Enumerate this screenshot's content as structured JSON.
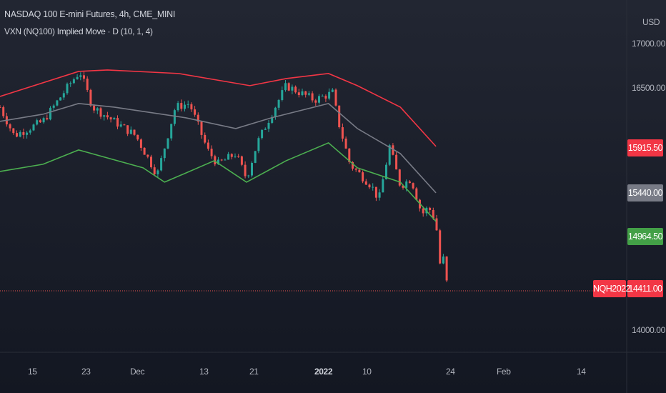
{
  "header": {
    "title": "NASDAQ 100 E-mini Futures, 4h, CME_MINI",
    "indicator": "VXN (NQ100) Implied Move · D (10, 1, 4)"
  },
  "price_axis": {
    "currency": "USD",
    "ticks": [
      "17000.00",
      "16500.00",
      "14000.00"
    ]
  },
  "time_axis": {
    "ticks": [
      "15",
      "23",
      "Dec",
      "13",
      "21",
      "2022",
      "10",
      "24",
      "Feb",
      "14"
    ]
  },
  "tags": {
    "upper": "15915.50",
    "mid": "15440.00",
    "lower": "14964.50",
    "last": "14411.00",
    "symbol": "NQH2022"
  },
  "colors": {
    "upper": "#f23645",
    "mid": "#787b86",
    "lower": "#4caf50",
    "up": "#26a69a",
    "down": "#ef5350"
  },
  "chart_data": {
    "type": "candlestick",
    "title": "NASDAQ 100 E-mini Futures, 4h, CME_MINI",
    "ylim": [
      13700,
      17300
    ],
    "x_unit": "days since 2021-11-10",
    "close": {
      "x": [
        0,
        2.1,
        6.4,
        10.6,
        11.9,
        13.8,
        17,
        20.2,
        23.4,
        26.1,
        28.2,
        30.9,
        32.4,
        35.1,
        36.7,
        38.3,
        40.4,
        42.6,
        44.7,
        46.8,
        49.5,
        50.5,
        52.1,
        55.3,
        56.4,
        58,
        59.6,
        61.2,
        62.8,
        63.8,
        64.9,
        65.4,
        66.2,
        66.6
      ],
      "y": [
        16334,
        16035,
        16185,
        16596,
        16708,
        16334,
        16185,
        16035,
        15624,
        16334,
        16372,
        15886,
        15736,
        15848,
        15586,
        15960,
        16260,
        16559,
        16484,
        16409,
        16484,
        16147,
        15736,
        15511,
        15362,
        15923,
        15511,
        15586,
        15212,
        15287,
        15138,
        14689,
        14764,
        14411
      ]
    },
    "series": [
      {
        "name": "Upper",
        "x": [
          0,
          11.7,
          16,
          26.6,
          37.2,
          42.6,
          48.9,
          53.2,
          59.6,
          64.9
        ],
        "y": [
          16446,
          16708,
          16723,
          16686,
          16559,
          16633,
          16686,
          16559,
          16334,
          15923
        ]
      },
      {
        "name": "Mid",
        "x": [
          0,
          6.4,
          11.7,
          17,
          27.7,
          35.1,
          40.4,
          48.9,
          53.2,
          59.6,
          64.9
        ],
        "y": [
          16185,
          16260,
          16372,
          16334,
          16222,
          16110,
          16222,
          16372,
          16110,
          15848,
          15437
        ]
      },
      {
        "name": "Lower",
        "x": [
          0,
          6.4,
          11.7,
          21.3,
          24.5,
          31.9,
          36.7,
          42.6,
          48.9,
          53.2,
          59.6,
          64.9
        ],
        "y": [
          15661,
          15736,
          15886,
          15699,
          15549,
          15773,
          15549,
          15773,
          15960,
          15699,
          15549,
          15138
        ]
      }
    ]
  }
}
